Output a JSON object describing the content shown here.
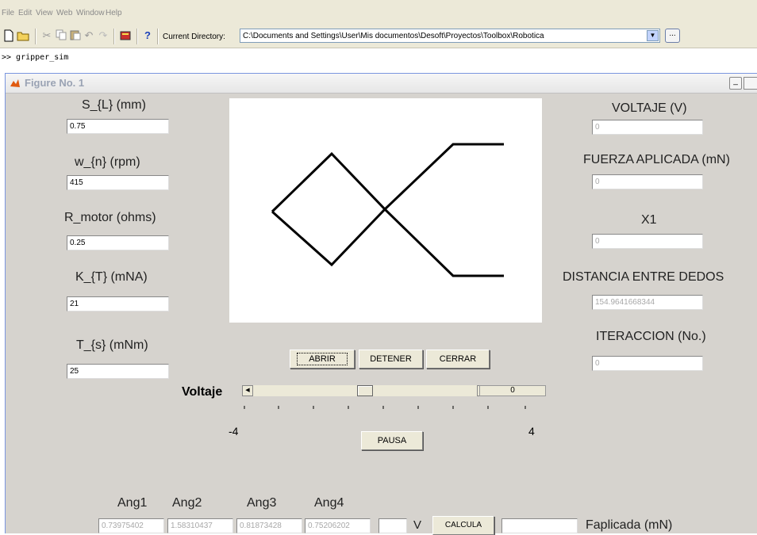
{
  "menu": [
    "File",
    "Edit",
    "View",
    "Web",
    "Window",
    "Help"
  ],
  "toolbar": {
    "help_glyph": "?",
    "current_directory_label": "Current Directory:",
    "current_directory_value": "C:\\Documents and Settings\\User\\Mis documentos\\Desoft\\Proyectos\\Toolbox\\Robotica",
    "browse_label": "..."
  },
  "command": "&gt;&gt; gripper_sim",
  "figure": {
    "title": "Figure No. 1",
    "left_params": [
      {
        "label": "S_{L} (mm)",
        "value": "0.75"
      },
      {
        "label": "w_{n} (rpm)",
        "value": "415"
      },
      {
        "label": "R_motor (ohms)",
        "value": "0.25"
      },
      {
        "label": "K_{T} (mNA)",
        "value": "21"
      },
      {
        "label": "T_{s} (mNm)",
        "value": "25"
      }
    ],
    "right_params": [
      {
        "label": "VOLTAJE (V)",
        "value": "0"
      },
      {
        "label": "FUERZA APLICADA (mN)",
        "value": "0"
      },
      {
        "label": "X1",
        "value": "0"
      },
      {
        "label": "DISTANCIA ENTRE DEDOS",
        "value": "154.9641668344"
      },
      {
        "label": "ITERACCION (No.)",
        "value": "0"
      }
    ],
    "buttons": {
      "abrir": "ABRIR",
      "detener": "DETENER",
      "cerrar": "CERRAR",
      "pausa": "PAUSA",
      "calcula": "CALCULA"
    },
    "slider": {
      "label": "Voltaje",
      "min_label": "-4",
      "max_label": "4",
      "value_text": "0",
      "position": 0.5
    },
    "angles": [
      {
        "label": "Ang1",
        "value": "0.73975402"
      },
      {
        "label": "Ang2",
        "value": "1.58310437"
      },
      {
        "label": "Ang3",
        "value": "0.81873428"
      },
      {
        "label": "Ang4",
        "value": "0.75206202"
      }
    ],
    "volt_input": "",
    "volt_unit": "V",
    "force_input": "",
    "force_label": "Faplicada (mN)"
  },
  "colors": {
    "figure_bg": "#d6d3ce",
    "toolbar_bg": "#ece9d8",
    "plot_bg": "#ffffff",
    "link": "#000000"
  }
}
